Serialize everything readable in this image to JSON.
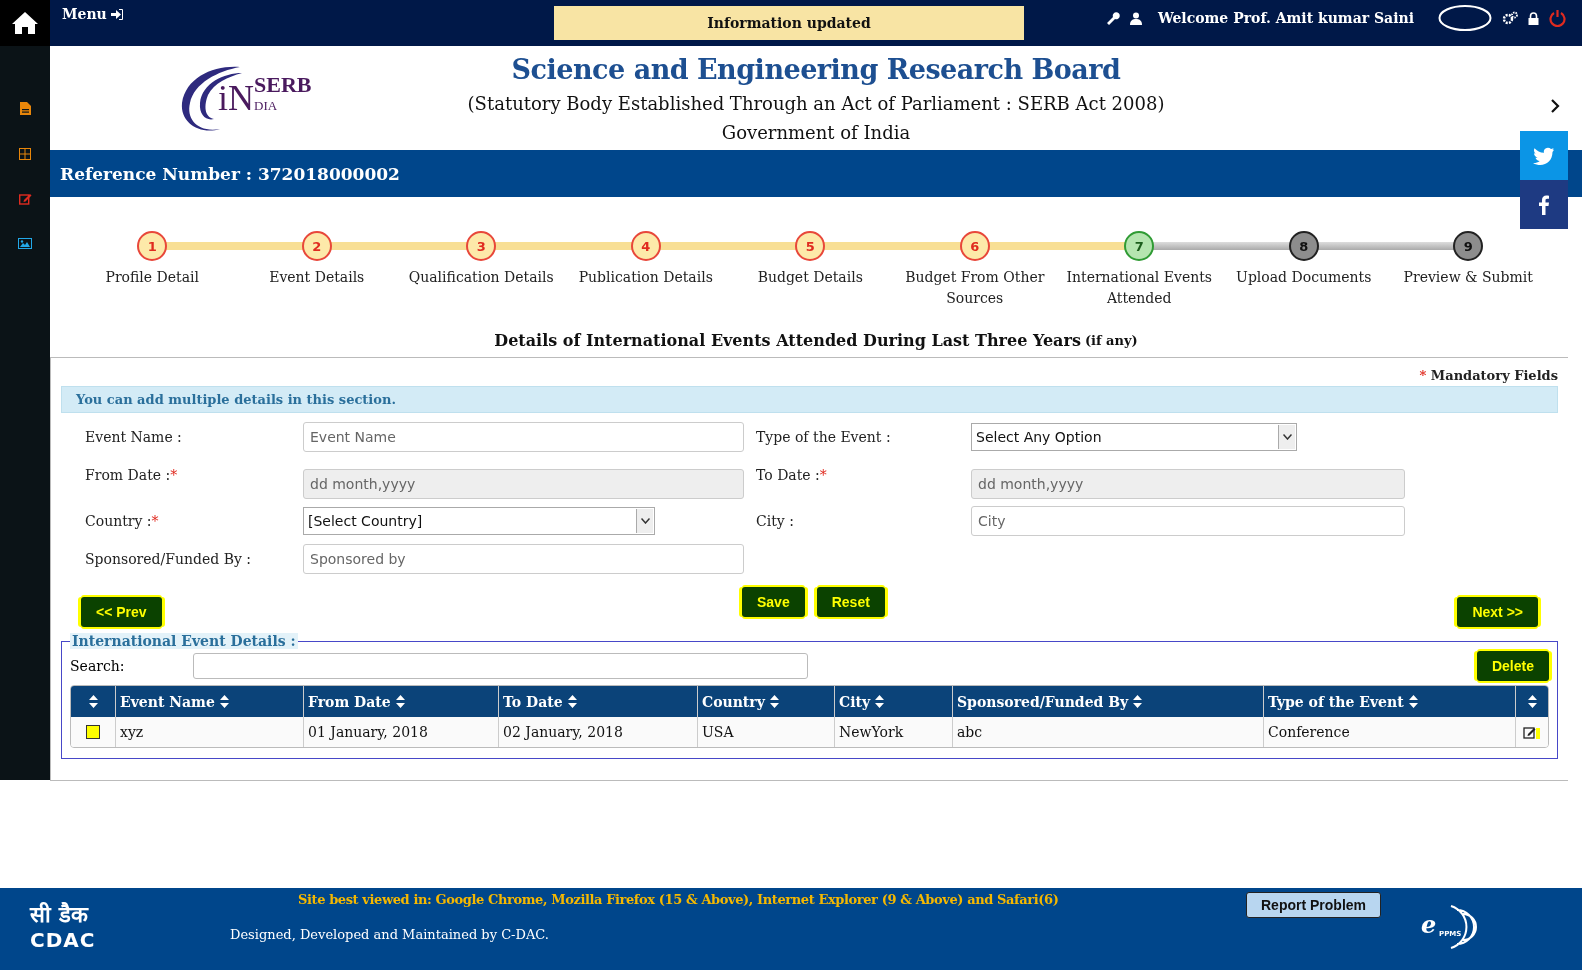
{
  "topbar": {
    "menu": "Menu",
    "notice": "Information updated",
    "welcome": "Welcome Prof. Amit kumar Saini"
  },
  "header": {
    "logo": {
      "mark": "iN",
      "top": "SERB",
      "bottom": "DIA"
    },
    "title": "Science and Engineering Research Board",
    "subtitle": "(Statutory Body Established Through an Act of Parliament : SERB Act 2008)",
    "gov": "Government of India"
  },
  "reference": "Reference Number : 372018000002",
  "steps": [
    {
      "num": "1",
      "label": "Profile Detail",
      "done": true,
      "current": false
    },
    {
      "num": "2",
      "label": "Event Details",
      "done": true,
      "current": false
    },
    {
      "num": "3",
      "label": "Qualification Details",
      "done": true,
      "current": false
    },
    {
      "num": "4",
      "label": "Publication Details",
      "done": true,
      "current": false
    },
    {
      "num": "5",
      "label": "Budget Details",
      "done": true,
      "current": false
    },
    {
      "num": "6",
      "label": "Budget From Other Sources",
      "done": true,
      "current": false
    },
    {
      "num": "7",
      "label": "International Events Attended",
      "done": false,
      "current": true
    },
    {
      "num": "8",
      "label": "Upload Documents",
      "done": false,
      "current": false
    },
    {
      "num": "9",
      "label": "Preview & Submit",
      "done": false,
      "current": false
    }
  ],
  "section_title": "Details of International Events Attended During Last Three Years",
  "section_note": "(if any)",
  "mandatory": "Mandatory Fields",
  "mandatory_mark": "*",
  "info": "You can add multiple details in this section.",
  "fields": [
    {
      "label": "Event Name :",
      "kind": "text",
      "placeholder": "Event Name",
      "required": false
    },
    {
      "label": "Type of the Event :",
      "kind": "select",
      "value": "Select Any Option",
      "required": false
    },
    {
      "label": "From Date :",
      "kind": "date",
      "placeholder": "dd month,yyyy",
      "required": true
    },
    {
      "label": "To Date :",
      "kind": "date",
      "placeholder": "dd month,yyyy",
      "required": true
    },
    {
      "label": "Country :",
      "kind": "select",
      "value": "[Select Country]",
      "required": true
    },
    {
      "label": "City :",
      "kind": "text",
      "placeholder": "City",
      "required": false
    },
    {
      "label": "Sponsored/Funded By :",
      "kind": "text",
      "placeholder": "Sponsored by",
      "required": false
    }
  ],
  "buttons": {
    "prev": "<< Prev",
    "save": "Save",
    "reset": "Reset",
    "next": "Next >>",
    "delete": "Delete"
  },
  "table": {
    "legend": "International Event Details :",
    "search_label": "Search:",
    "columns": [
      "",
      "Event Name",
      "From Date",
      "To Date",
      "Country",
      "City",
      "Sponsored/Funded By",
      "Type of the Event",
      ""
    ],
    "rows": [
      {
        "checked": false,
        "cells": [
          "",
          "xyz",
          "01 January, 2018",
          "02 January, 2018",
          "USA",
          "NewYork",
          "abc",
          "Conference",
          ""
        ]
      }
    ]
  },
  "footer": {
    "cdac_hindi": "सी डैक",
    "cdac": "CDAC",
    "browsers": "Site best viewed in: Google Chrome, Mozilla Firefox (15 & Above), Internet Explorer (9 & Above) and Safari(6)",
    "credit": "Designed, Developed and Maintained by C-DAC.",
    "report": "Report Problem",
    "eppms_e": "e",
    "eppms": "PPMS"
  }
}
